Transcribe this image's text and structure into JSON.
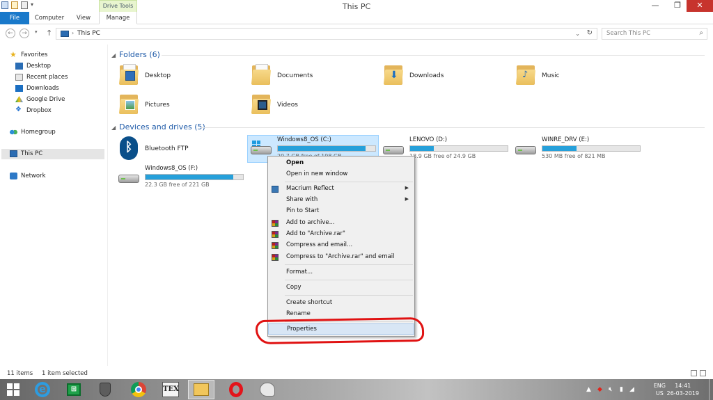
{
  "window": {
    "title": "This PC",
    "controls": {
      "minimize": "—",
      "maximize": "❐",
      "close": "✕"
    },
    "contextual_tab": "Drive Tools"
  },
  "ribbon": {
    "tabs": [
      "File",
      "Computer",
      "View",
      "Manage"
    ]
  },
  "address_bar": {
    "path": "This PC",
    "search_placeholder": "Search This PC"
  },
  "nav_pane": {
    "favorites_label": "Favorites",
    "favorites": [
      "Desktop",
      "Recent places",
      "Downloads",
      "Google Drive",
      "Dropbox"
    ],
    "homegroup": "Homegroup",
    "this_pc": "This PC",
    "network": "Network"
  },
  "folders": {
    "header": "Folders (6)",
    "items": [
      "Desktop",
      "Documents",
      "Downloads",
      "Music",
      "Pictures",
      "Videos"
    ]
  },
  "devices": {
    "header": "Devices and drives (5)",
    "bluetooth": "Bluetooth FTP",
    "drives": [
      {
        "name": "Windows8_OS (C:)",
        "free_text": "20.7 GB free of 198 GB",
        "used_fraction": 0.9
      },
      {
        "name": "LENOVO (D:)",
        "free_text": "18.9 GB free of 24.9 GB",
        "used_fraction": 0.24
      },
      {
        "name": "WINRE_DRV (E:)",
        "free_text": "530 MB free of 821 MB",
        "used_fraction": 0.35
      },
      {
        "name": "Windows8_OS (F:)",
        "free_text": "22.3 GB free of 221 GB",
        "used_fraction": 0.9
      }
    ]
  },
  "context_menu": {
    "items": [
      "Open",
      "Open in new window",
      "Macrium Reflect",
      "Share with",
      "Pin to Start",
      "Add to archive...",
      "Add to \"Archive.rar\"",
      "Compress and email...",
      "Compress to \"Archive.rar\" and email",
      "Format...",
      "Copy",
      "Create shortcut",
      "Rename",
      "Properties"
    ]
  },
  "status_bar": {
    "items_count": "11 items",
    "selected": "1 item selected"
  },
  "taskbar": {
    "tex_label": "TEX",
    "lang": "ENG",
    "region": "US",
    "time": "14:41",
    "date": "26-03-2019"
  },
  "colors": {
    "accent": "#1979ca",
    "drive_bar": "#26a0da",
    "selection": "#cce8ff",
    "annotation": "#e01212"
  }
}
